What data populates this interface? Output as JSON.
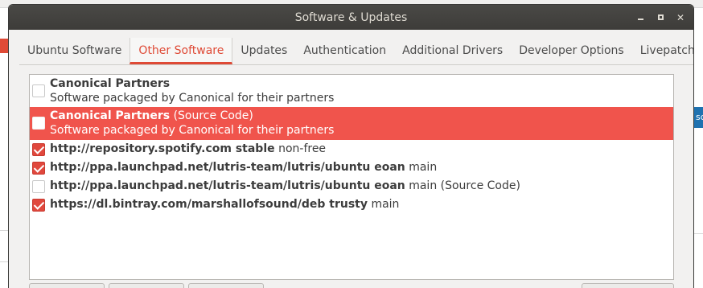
{
  "window": {
    "title": "Software & Updates"
  },
  "tabs": [
    {
      "label": "Ubuntu Software",
      "active": false
    },
    {
      "label": "Other Software",
      "active": true
    },
    {
      "label": "Updates",
      "active": false
    },
    {
      "label": "Authentication",
      "active": false
    },
    {
      "label": "Additional Drivers",
      "active": false
    },
    {
      "label": "Developer Options",
      "active": false
    },
    {
      "label": "Livepatch",
      "active": false
    }
  ],
  "sources": [
    {
      "title": "Canonical Partners",
      "suffix": "",
      "subtitle": "Software packaged by Canonical for their partners",
      "checked": false,
      "selected": false
    },
    {
      "title": "Canonical Partners",
      "suffix": " (Source Code)",
      "subtitle": "Software packaged by Canonical for their partners",
      "checked": false,
      "selected": true
    },
    {
      "title": "http://repository.spotify.com stable",
      "suffix": " non-free",
      "checked": true,
      "selected": false
    },
    {
      "title": "http://ppa.launchpad.net/lutris-team/lutris/ubuntu eoan",
      "suffix": " main",
      "checked": true,
      "selected": false
    },
    {
      "title": "http://ppa.launchpad.net/lutris-team/lutris/ubuntu eoan",
      "suffix": " main (Source Code)",
      "checked": false,
      "selected": false
    },
    {
      "title": "https://dl.bintray.com/marshallofsound/deb trusty",
      "suffix": " main",
      "checked": true,
      "selected": false
    }
  ],
  "background": {
    "right_button_text": "sc"
  },
  "colors": {
    "accent": "#df4a36",
    "selection": "#f0544c",
    "titlebar": "#3d3c39"
  }
}
